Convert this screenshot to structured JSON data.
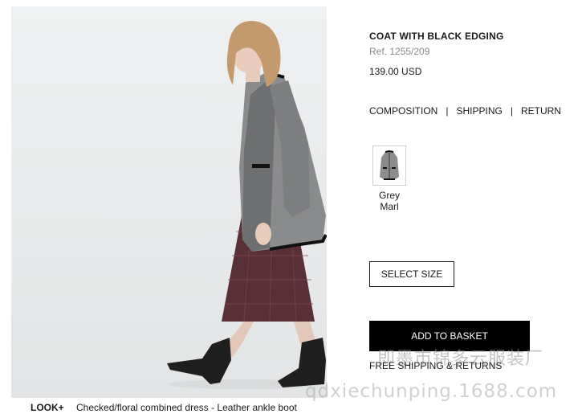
{
  "product": {
    "title": "COAT WITH BLACK EDGING",
    "ref": "Ref. 1255/209",
    "price": "139.00 USD"
  },
  "info_tabs": {
    "composition": "COMPOSITION",
    "shipping": "SHIPPING",
    "return": "RETURN",
    "separator": "|"
  },
  "colors": [
    {
      "name": "Grey Marl",
      "hex": "#8c8c8c"
    }
  ],
  "buttons": {
    "select_size": "SELECT SIZE",
    "add_to_basket": "ADD TO BASKET"
  },
  "shipping_note": "FREE SHIPPING & RETURNS",
  "look": {
    "label": "LOOK+",
    "items": "Checked/floral combined dress  -  Leather ankle boot"
  },
  "watermarks": {
    "chinese": "即墨市锦多云服装厂",
    "url": "qdxiechunping.1688.com"
  }
}
